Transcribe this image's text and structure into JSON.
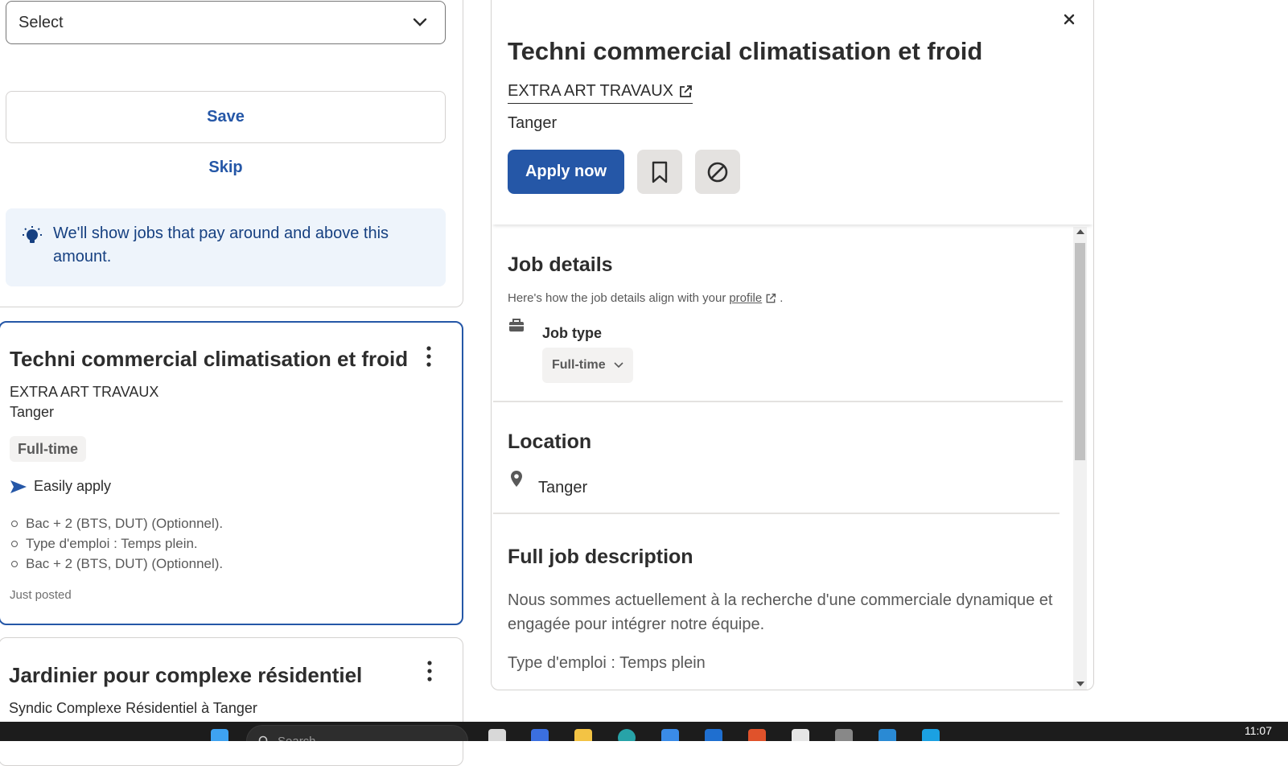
{
  "filters": {
    "select_label": "Select",
    "save_label": "Save",
    "skip_label": "Skip",
    "info_text": "We'll show jobs that pay around and above this amount."
  },
  "job_list": [
    {
      "title": "Techni commercial climatisation et froid",
      "company": "EXTRA ART TRAVAUX",
      "location": "Tanger",
      "tag": "Full-time",
      "easy_apply": "Easily apply",
      "bullets": [
        "Bac + 2 (BTS, DUT) (Optionnel).",
        "Type d'emploi : Temps plein.",
        "Bac + 2 (BTS, DUT) (Optionnel)."
      ],
      "posted": "Just posted"
    },
    {
      "title": "Jardinier pour complexe résidentiel",
      "company": "Syndic Complexe Résidentiel à Tanger"
    }
  ],
  "detail": {
    "title": "Techni commercial climatisation et froid",
    "company": "EXTRA ART TRAVAUX",
    "location": "Tanger",
    "apply_label": "Apply now",
    "job_details_title": "Job details",
    "align_note": "Here's how the job details align with your",
    "profile_link": "profile",
    "align_note_end": ".",
    "job_type_label": "Job type",
    "job_type_value": "Full-time",
    "location_title": "Location",
    "location_value": "Tanger",
    "description_title": "Full job description",
    "description_paragraphs": [
      "Nous sommes actuellement à la recherche d'une commerciale dynamique et engagée pour intégrer notre équipe.",
      "Type d'emploi : Temps plein"
    ]
  },
  "taskbar": {
    "search_placeholder": "Search",
    "clock": "11:07"
  },
  "colors": {
    "accent": "#2557a7",
    "info_bg": "#eef4fb",
    "info_text": "#164081",
    "tag_bg": "#f3f2f1",
    "taskbar": "#1c1c1c"
  },
  "icons": [
    "chevron-down-icon",
    "lightbulb-icon",
    "more-vertical-icon",
    "send-icon",
    "close-icon",
    "external-link-icon",
    "bookmark-icon",
    "not-interested-icon",
    "briefcase-icon",
    "location-pin-icon",
    "search-icon"
  ]
}
